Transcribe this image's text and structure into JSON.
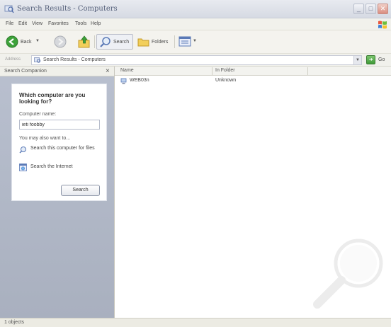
{
  "window": {
    "title": "Search Results - Computers"
  },
  "menu": {
    "items": [
      "File",
      "Edit",
      "View",
      "Favorites",
      "Tools",
      "Help"
    ]
  },
  "toolbar": {
    "back_label": "Back",
    "search_label": "Search",
    "folders_label": "Folders"
  },
  "address": {
    "label": "Address",
    "value": "Search Results - Computers",
    "go_label": "Go"
  },
  "search_pane": {
    "title": "Search Companion",
    "heading": "Which computer are you looking for?",
    "name_label": "Computer name:",
    "name_value": "ieti foobby",
    "also_label": "You may also want to...",
    "options": [
      "Search this computer for files",
      "Search the Internet"
    ],
    "search_button": "Search"
  },
  "results": {
    "columns": [
      "Name",
      "In Folder"
    ],
    "rows": [
      {
        "name": "WEB03n",
        "folder": "Unknown"
      }
    ]
  },
  "status": {
    "text": "1 objects"
  },
  "colors": {
    "pane_bg": "#aeb5c4",
    "accent_go": "#3f9a38"
  }
}
